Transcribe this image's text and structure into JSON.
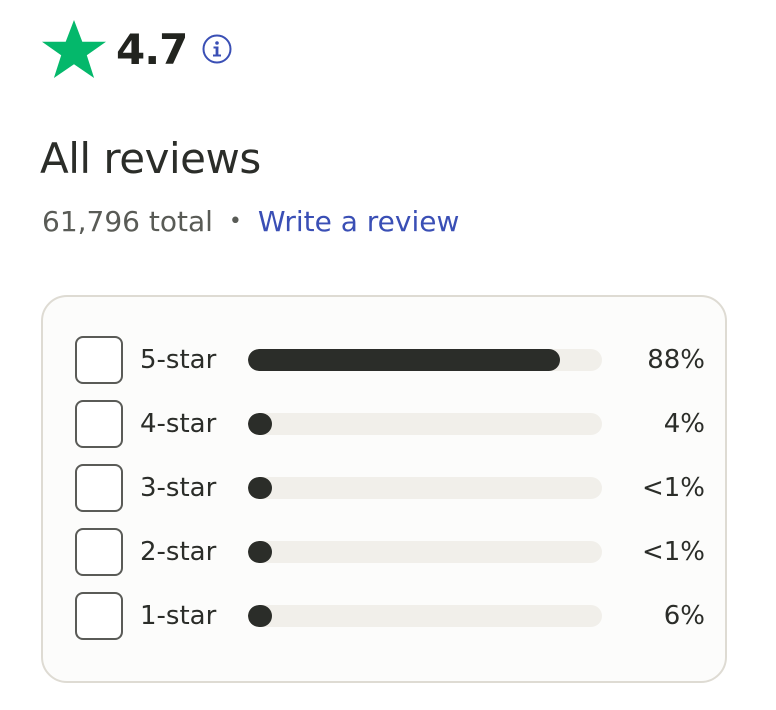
{
  "rating": {
    "value": "4.7",
    "icon": "star-icon",
    "info_icon": "info-icon",
    "star_color": "#04b86b"
  },
  "reviews": {
    "title": "All reviews",
    "total": "61,796 total",
    "separator": "•",
    "write_link": "Write a review",
    "link_color": "#3a4fb5"
  },
  "filters": [
    {
      "label": "5-star",
      "percent": "88%",
      "fill": 0.88
    },
    {
      "label": "4-star",
      "percent": "4%",
      "fill": 0.04
    },
    {
      "label": "3-star",
      "percent": "<1%",
      "fill": 0.005
    },
    {
      "label": "2-star",
      "percent": "<1%",
      "fill": 0.005
    },
    {
      "label": "1-star",
      "percent": "6%",
      "fill": 0.06
    }
  ]
}
